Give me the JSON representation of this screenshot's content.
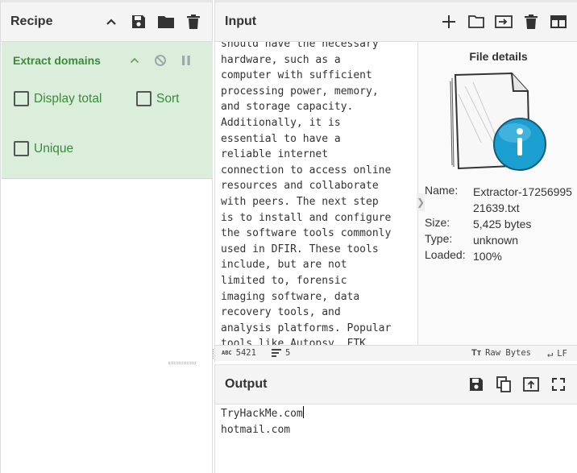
{
  "recipe": {
    "title": "Recipe",
    "icons": [
      "chevron-up-icon",
      "save-icon",
      "folder-icon",
      "trash-icon"
    ],
    "operation": {
      "name": "Extract domains",
      "options": {
        "display_total": "Display total",
        "sort": "Sort",
        "unique": "Unique"
      }
    }
  },
  "input": {
    "title": "Input",
    "lines": [
      "should have the necessary",
      "hardware, such as a",
      "computer with sufficient",
      "processing power, memory,",
      "and storage capacity.",
      "Additionally, it is",
      "essential to have a",
      "reliable internet",
      "connection to access online",
      "resources and collaborate",
      "with peers. The next step",
      "is to install and configure",
      "the software tools commonly",
      "used in DFIR. These tools",
      "include, but are not",
      "limited to, forensic",
      "imaging software, data",
      "recovery tools, and",
      "analysis platforms. Popular",
      "tools like Autopsy, FTK"
    ],
    "status": {
      "length": "5421",
      "lines": "5",
      "encoding": "Raw Bytes",
      "eol": "LF"
    }
  },
  "file_details": {
    "title": "File details",
    "name_label": "Name:",
    "name_value": "Extractor-1725699521639.txt",
    "size_label": "Size:",
    "size_value": "5,425 bytes",
    "type_label": "Type:",
    "type_value": "unknown",
    "loaded_label": "Loaded:",
    "loaded_value": "100%"
  },
  "output": {
    "title": "Output",
    "lines": [
      "TryHackMe.com",
      "hotmail.com"
    ]
  },
  "colors": {
    "operation_bg": "#dbeedb",
    "operation_text": "#3a8a3a",
    "info_blue": "#1a9fd0"
  }
}
